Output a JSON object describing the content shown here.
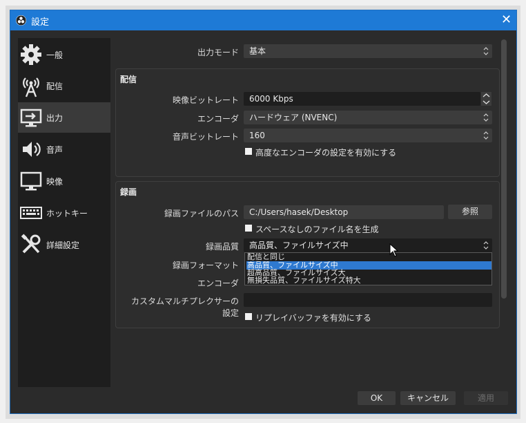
{
  "window": {
    "title": "設定",
    "close": "✕"
  },
  "sidebar": {
    "items": [
      {
        "label": "一般",
        "icon": "gear-icon"
      },
      {
        "label": "配信",
        "icon": "antenna-icon"
      },
      {
        "label": "出力",
        "icon": "output-monitor-icon",
        "active": true
      },
      {
        "label": "音声",
        "icon": "speaker-icon"
      },
      {
        "label": "映像",
        "icon": "monitor-icon"
      },
      {
        "label": "ホットキー",
        "icon": "keyboard-icon"
      },
      {
        "label": "詳細設定",
        "icon": "tools-icon"
      }
    ]
  },
  "output_mode": {
    "label": "出力モード",
    "value": "基本"
  },
  "streaming": {
    "title": "配信",
    "video_bitrate": {
      "label": "映像ビットレート",
      "value": "6000 Kbps"
    },
    "encoder": {
      "label": "エンコーダ",
      "value": "ハードウェア (NVENC)"
    },
    "audio_bitrate": {
      "label": "音声ビットレート",
      "value": "160"
    },
    "advanced_checkbox": "高度なエンコーダの設定を有効にする"
  },
  "recording": {
    "title": "録画",
    "path": {
      "label": "録画ファイルのパス",
      "value": "C:/Users/hasek/Desktop",
      "browse": "参照"
    },
    "no_space_checkbox": "スペースなしのファイル名を生成",
    "quality": {
      "label": "録画品質",
      "value": "高品質、ファイルサイズ中",
      "options": [
        "配信と同じ",
        "高品質、ファイルサイズ中",
        "超高品質、ファイルサイズ大",
        "無損失品質、ファイルサイズ特大"
      ],
      "selected_index": 1
    },
    "format_label": "録画フォーマット",
    "encoder_label": "エンコーダ",
    "muxer": {
      "label": "カスタムマルチプレクサーの設定",
      "value": ""
    },
    "replay_checkbox": "リプレイバッファを有効にする"
  },
  "footer": {
    "ok": "OK",
    "cancel": "キャンセル",
    "apply": "適用"
  }
}
